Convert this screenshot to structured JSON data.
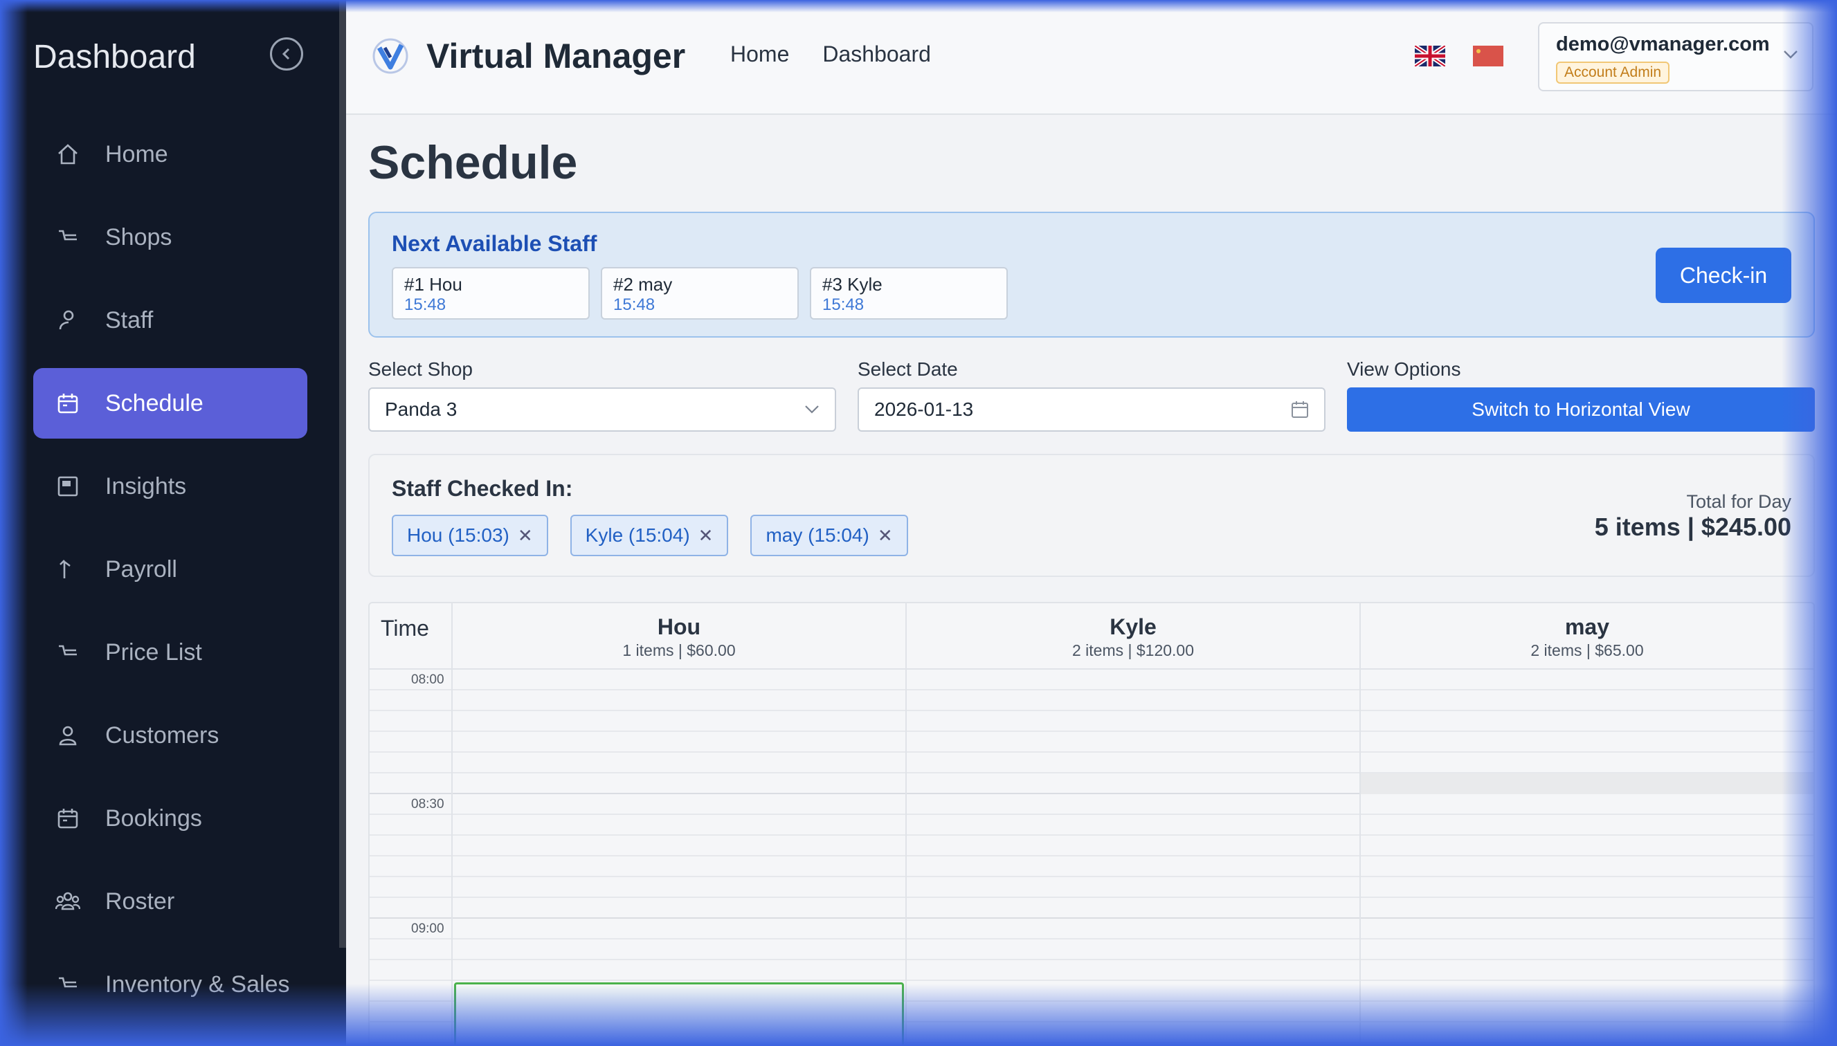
{
  "sidebar": {
    "title": "Dashboard",
    "items": [
      {
        "label": "Home",
        "icon": "home-icon"
      },
      {
        "label": "Shops",
        "icon": "shop-icon"
      },
      {
        "label": "Staff",
        "icon": "staff-icon"
      },
      {
        "label": "Schedule",
        "icon": "calendar-icon",
        "active": true
      },
      {
        "label": "Insights",
        "icon": "insights-icon"
      },
      {
        "label": "Payroll",
        "icon": "payroll-icon"
      },
      {
        "label": "Price List",
        "icon": "price-list-icon"
      },
      {
        "label": "Customers",
        "icon": "user-icon"
      },
      {
        "label": "Bookings",
        "icon": "calendar-icon"
      },
      {
        "label": "Roster",
        "icon": "team-icon"
      },
      {
        "label": "Inventory & Sales",
        "icon": "inventory-icon"
      }
    ]
  },
  "header": {
    "brand": "Virtual Manager",
    "nav": [
      "Home",
      "Dashboard"
    ],
    "account": {
      "email": "demo@vmanager.com",
      "role": "Account Admin"
    }
  },
  "page": {
    "title": "Schedule"
  },
  "next_available": {
    "title": "Next Available Staff",
    "staff": [
      {
        "name": "#1 Hou",
        "time": "15:48"
      },
      {
        "name": "#2 may",
        "time": "15:48"
      },
      {
        "name": "#3 Kyle",
        "time": "15:48"
      }
    ],
    "checkin_label": "Check-in"
  },
  "filters": {
    "shop_label": "Select Shop",
    "shop_value": "Panda 3",
    "date_label": "Select Date",
    "date_value": "2026-01-13",
    "view_label": "View Options",
    "view_button": "Switch to Horizontal View"
  },
  "checked_in": {
    "title": "Staff Checked In:",
    "chips": [
      "Hou (15:03)",
      "Kyle (15:04)",
      "may (15:04)"
    ],
    "total_label": "Total for Day",
    "total_value": "5 items | $245.00"
  },
  "schedule": {
    "time_header": "Time",
    "columns": [
      {
        "name": "Hou",
        "summary": "1 items | $60.00"
      },
      {
        "name": "Kyle",
        "summary": "2 items | $120.00"
      },
      {
        "name": "may",
        "summary": "2 items | $65.00"
      }
    ],
    "time_labels": [
      "08:00",
      "08:30",
      "09:00"
    ]
  },
  "colors": {
    "sidebar_bg": "#111827",
    "active_item": "#5b5fd8",
    "primary": "#2d6fe6",
    "appointment_border": "#4bb24b"
  }
}
